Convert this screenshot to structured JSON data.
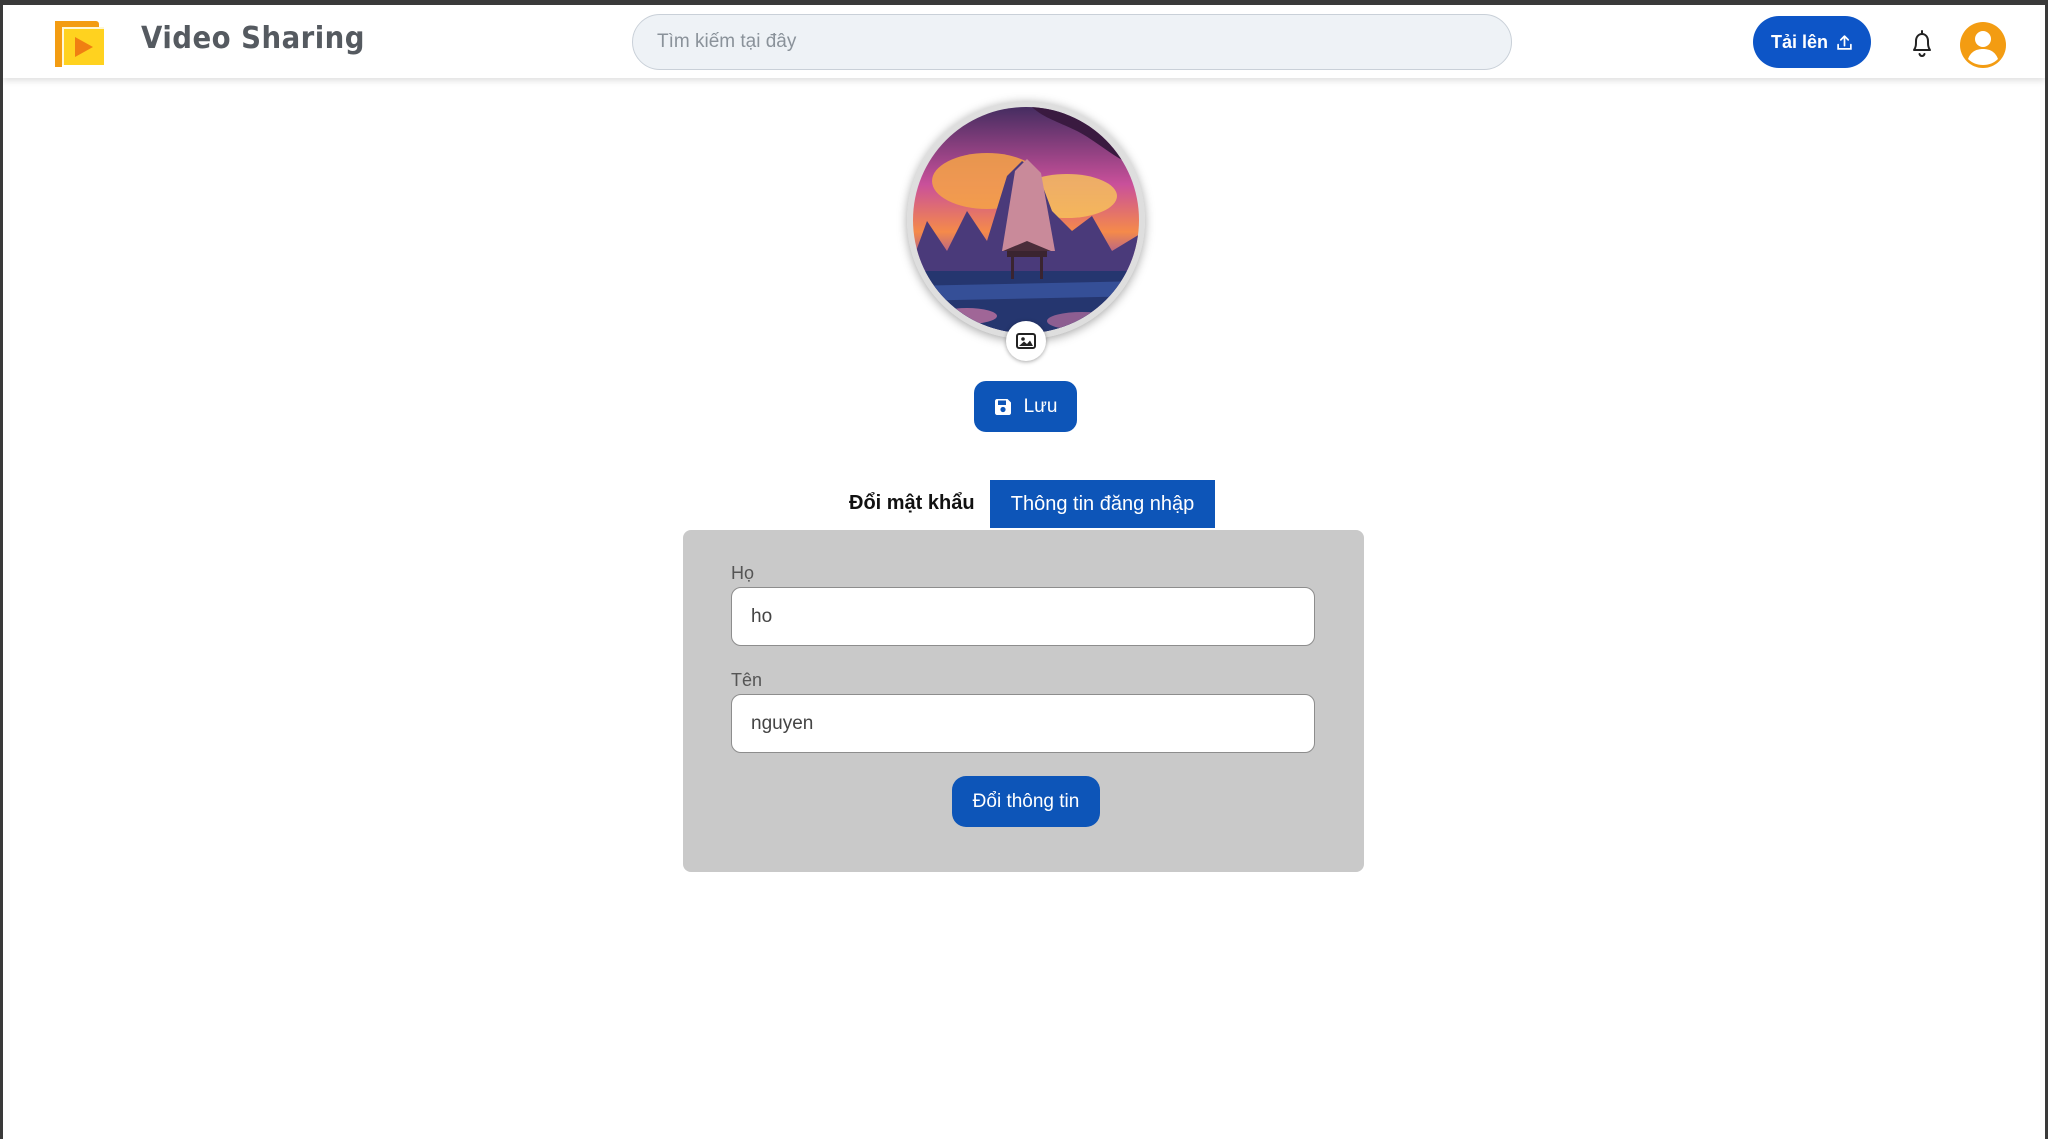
{
  "header": {
    "brand": "Video Sharing",
    "search_placeholder": "Tìm kiếm tại đây",
    "upload_label": "Tải lên"
  },
  "profile": {
    "save_label": "Lưu"
  },
  "tabs": [
    {
      "label": "Đổi mật khẩu",
      "active": false
    },
    {
      "label": "Thông tin đăng nhập",
      "active": true
    }
  ],
  "form": {
    "last_name_label": "Họ",
    "last_name_value": "ho",
    "first_name_label": "Tên",
    "first_name_value": "nguyen",
    "submit_label": "Đổi thông tin"
  },
  "colors": {
    "primary": "#0d55b8",
    "upload": "#0d55c7",
    "avatar_orange": "#f39c12",
    "card_bg": "#c9c9c9"
  },
  "icons": {
    "logo": "play-logo-icon",
    "upload": "upload-icon",
    "bell": "bell-icon",
    "user": "user-avatar-icon",
    "image": "image-icon",
    "save": "floppy-disk-icon"
  }
}
